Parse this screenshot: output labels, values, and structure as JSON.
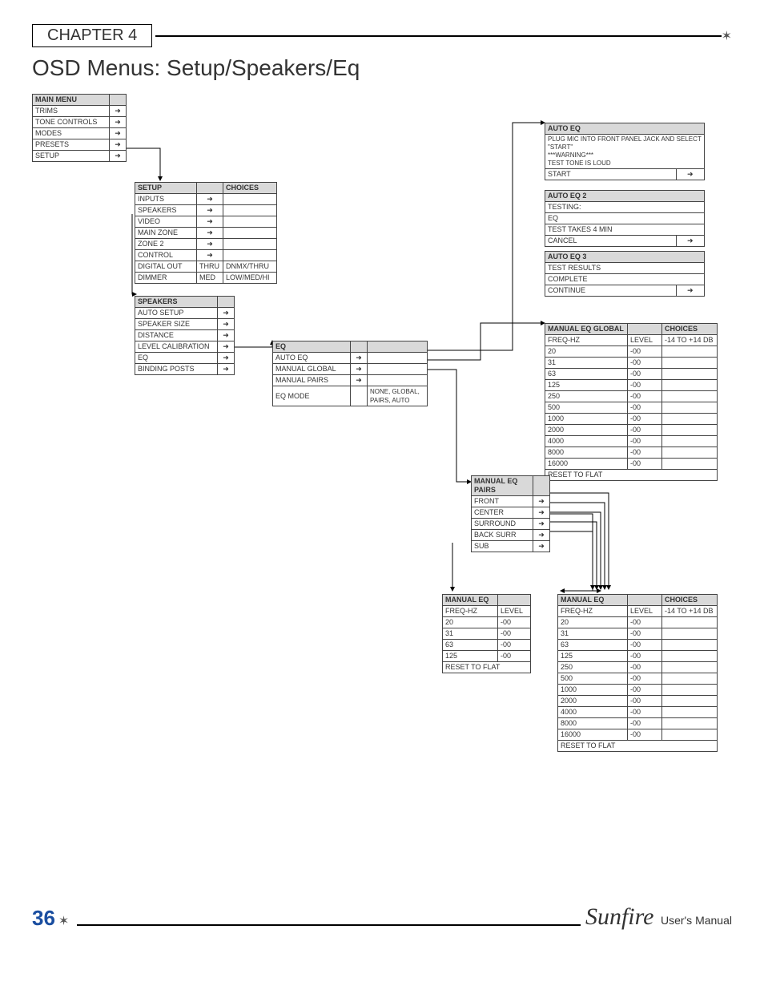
{
  "chapter": "CHAPTER 4",
  "title": "OSD Menus: Setup/Speakers/Eq",
  "page_number": "36",
  "brand": "Sunfire",
  "manual": "User's Manual",
  "main_menu": {
    "header": "MAIN MENU",
    "rows": [
      "TRIMS",
      "TONE CONTROLS",
      "MODES",
      "PRESETS",
      "SETUP"
    ]
  },
  "setup_menu": {
    "cols": [
      "SETUP",
      "",
      "CHOICES"
    ],
    "rows": [
      [
        "INPUTS",
        "→",
        ""
      ],
      [
        "SPEAKERS",
        "→",
        ""
      ],
      [
        "VIDEO",
        "→",
        ""
      ],
      [
        "MAIN ZONE",
        "→",
        ""
      ],
      [
        "ZONE 2",
        "→",
        ""
      ],
      [
        "CONTROL",
        "→",
        ""
      ],
      [
        "DIGITAL OUT",
        "THRU",
        "DNMX/THRU"
      ],
      [
        "DIMMER",
        "MED",
        "LOW/MED/HI"
      ]
    ]
  },
  "speakers_menu": {
    "header": "SPEAKERS",
    "rows": [
      "AUTO SETUP",
      "SPEAKER SIZE",
      "DISTANCE",
      "LEVEL CALIBRATION",
      "EQ",
      "BINDING POSTS"
    ]
  },
  "eq_menu": {
    "header": "EQ",
    "rows": [
      [
        "AUTO EQ",
        "",
        "→"
      ],
      [
        "MANUAL GLOBAL",
        "",
        "→"
      ],
      [
        "MANUAL PAIRS",
        "",
        "→"
      ],
      [
        "EQ MODE",
        "",
        "NONE, GLOBAL, PAIRS, AUTO"
      ]
    ]
  },
  "auto_eq": {
    "header": "AUTO EQ",
    "body": "PLUG MIC INTO FRONT PANEL JACK AND SELECT \"START\"\n***WARNING***\nTEST TONE IS LOUD",
    "start": "START"
  },
  "auto_eq2": {
    "header": "AUTO EQ 2",
    "lines": [
      "TESTING:",
      "EQ",
      "TEST TAKES 4 MIN"
    ],
    "cancel": "CANCEL"
  },
  "auto_eq3": {
    "header": "AUTO EQ 3",
    "lines": [
      "TEST RESULTS",
      "COMPLETE"
    ],
    "cont": "CONTINUE"
  },
  "manual_global": {
    "header": [
      "MANUAL EQ GLOBAL",
      "",
      "CHOICES"
    ],
    "sub": [
      "FREQ-HZ",
      "LEVEL",
      "-14 TO +14 DB"
    ],
    "rows": [
      [
        "20",
        "-00",
        ""
      ],
      [
        "31",
        "-00",
        ""
      ],
      [
        "63",
        "-00",
        ""
      ],
      [
        "125",
        "-00",
        ""
      ],
      [
        "250",
        "-00",
        ""
      ],
      [
        "500",
        "-00",
        ""
      ],
      [
        "1000",
        "-00",
        ""
      ],
      [
        "2000",
        "-00",
        ""
      ],
      [
        "4000",
        "-00",
        ""
      ],
      [
        "8000",
        "-00",
        ""
      ],
      [
        "16000",
        "-00",
        ""
      ]
    ],
    "reset": "RESET TO FLAT"
  },
  "manual_pairs": {
    "header": "MANUAL EQ PAIRS",
    "rows": [
      "FRONT",
      "CENTER",
      "SURROUND",
      "BACK SURR",
      "SUB"
    ]
  },
  "manual_eq_small": {
    "header": "MANUAL EQ",
    "sub": [
      "FREQ-HZ",
      "LEVEL"
    ],
    "rows": [
      [
        "20",
        "-00"
      ],
      [
        "31",
        "-00"
      ],
      [
        "63",
        "-00"
      ],
      [
        "125",
        "-00"
      ]
    ],
    "reset": "RESET TO FLAT"
  },
  "manual_eq_full": {
    "header": [
      "MANUAL EQ",
      "",
      "CHOICES"
    ],
    "sub": [
      "FREQ-HZ",
      "LEVEL",
      "-14 TO +14 DB"
    ],
    "rows": [
      [
        "20",
        "-00",
        ""
      ],
      [
        "31",
        "-00",
        ""
      ],
      [
        "63",
        "-00",
        ""
      ],
      [
        "125",
        "-00",
        ""
      ],
      [
        "250",
        "-00",
        ""
      ],
      [
        "500",
        "-00",
        ""
      ],
      [
        "1000",
        "-00",
        ""
      ],
      [
        "2000",
        "-00",
        ""
      ],
      [
        "4000",
        "-00",
        ""
      ],
      [
        "8000",
        "-00",
        ""
      ],
      [
        "16000",
        "-00",
        ""
      ]
    ],
    "reset": "RESET TO FLAT"
  }
}
